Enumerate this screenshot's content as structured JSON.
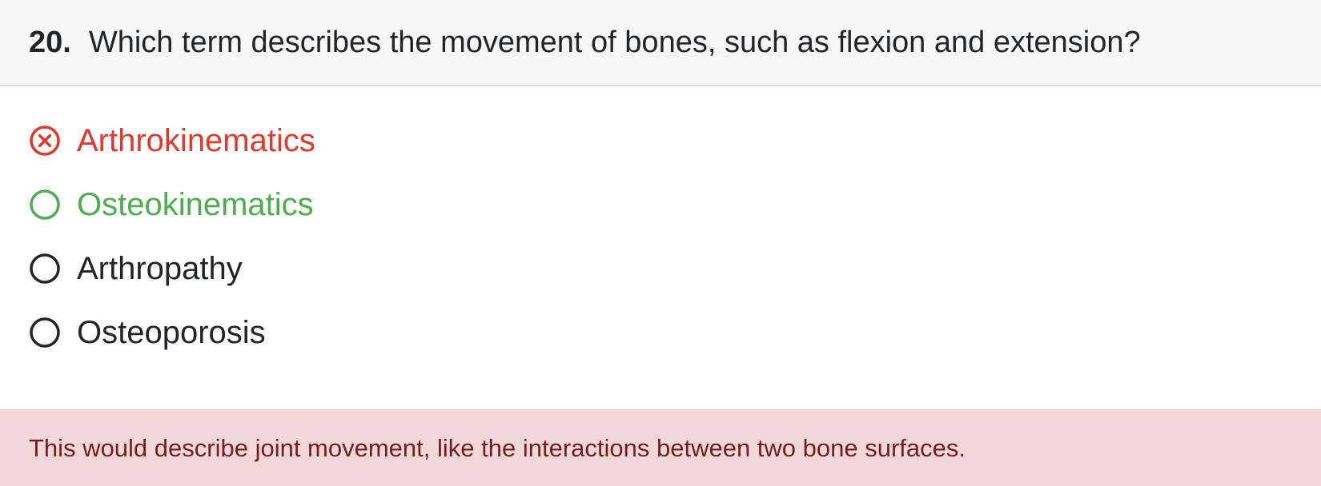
{
  "question": {
    "number": "20.",
    "text": "Which term describes the movement of bones, such as flexion and extension?"
  },
  "options": [
    {
      "label": "Arthrokinematics",
      "state": "incorrect-selected",
      "icon": "x-circle-icon",
      "color": "#e03a2f"
    },
    {
      "label": "Osteokinematics",
      "state": "correct",
      "icon": "circle-icon",
      "color": "#4fad4e"
    },
    {
      "label": "Arthropathy",
      "state": "unselected",
      "icon": "circle-icon",
      "color": "#212529"
    },
    {
      "label": "Osteoporosis",
      "state": "unselected",
      "icon": "circle-icon",
      "color": "#212529"
    }
  ],
  "feedback": {
    "text": "This would describe joint movement, like the interactions between two bone surfaces.",
    "background": "#f2d7d9",
    "color": "#6f1f25"
  }
}
